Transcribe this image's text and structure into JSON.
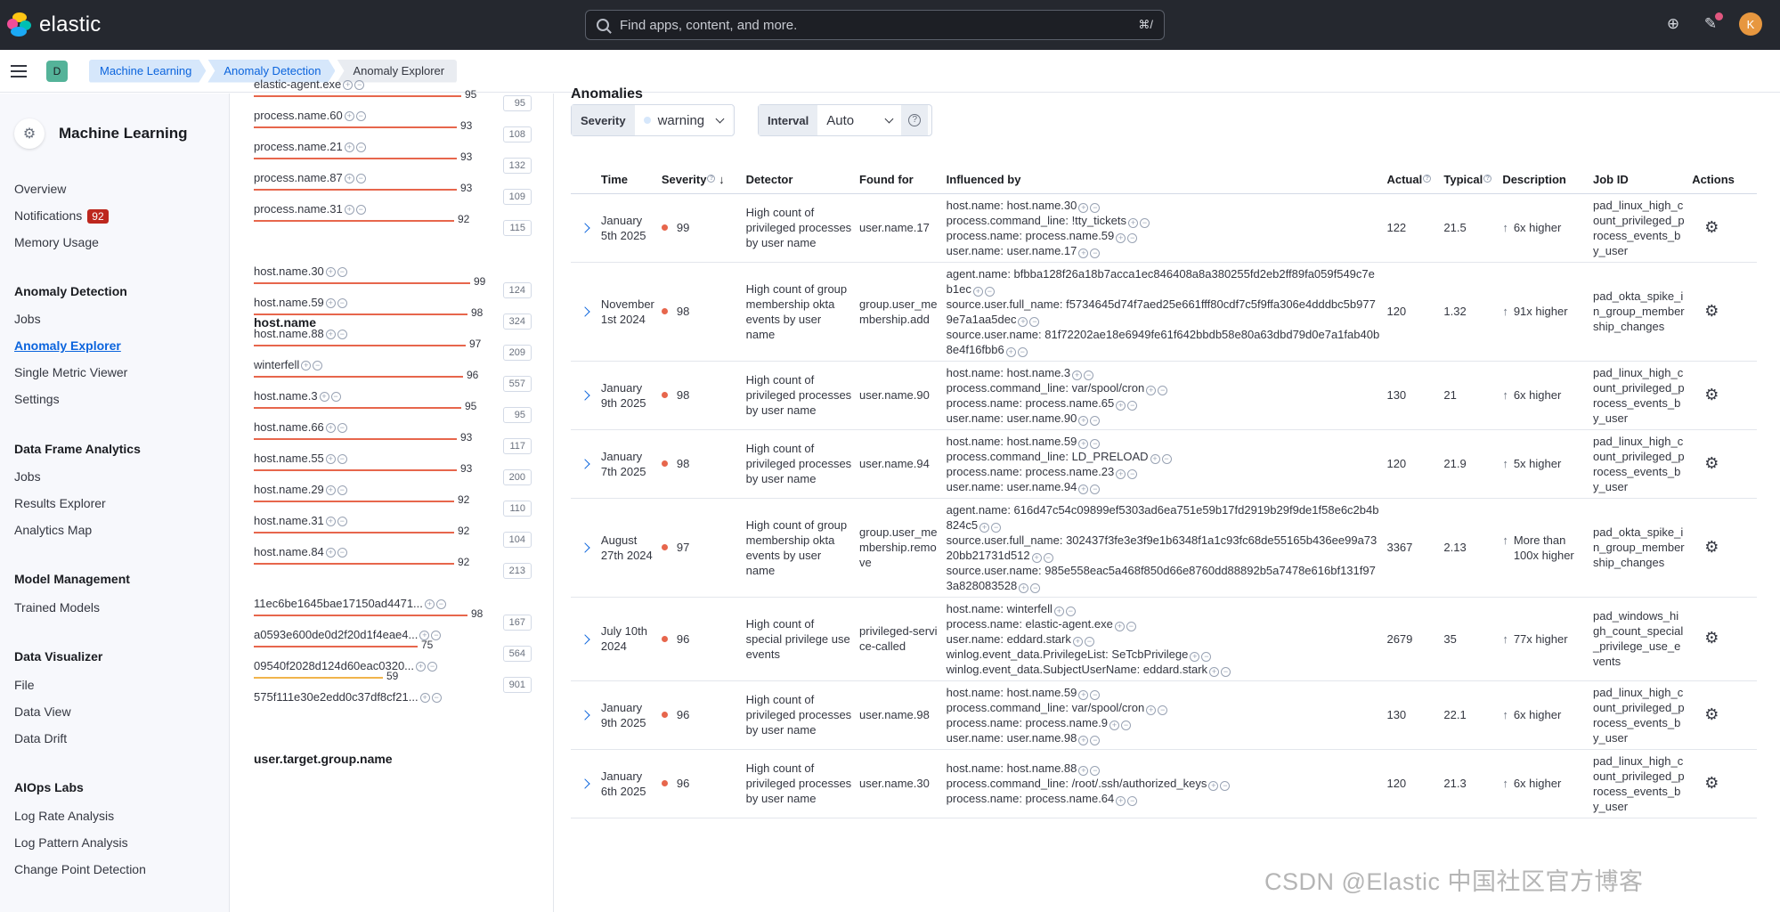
{
  "header": {
    "brand": "elastic",
    "search_placeholder": "Find apps, content, and more.",
    "search_shortcut": "⌘/",
    "avatar_initial": "K"
  },
  "breadcrumb": {
    "space_initial": "D",
    "items": [
      "Machine Learning",
      "Anomaly Detection",
      "Anomaly Explorer"
    ]
  },
  "sidebar": {
    "title": "Machine Learning",
    "top_items": [
      "Overview",
      "Notifications",
      "Memory Usage"
    ],
    "notifications_count": "92",
    "sections": [
      {
        "title": "Anomaly Detection",
        "items": [
          "Jobs",
          "Anomaly Explorer",
          "Single Metric Viewer",
          "Settings"
        ]
      },
      {
        "title": "Data Frame Analytics",
        "items": [
          "Jobs",
          "Results Explorer",
          "Analytics Map"
        ]
      },
      {
        "title": "Model Management",
        "items": [
          "Trained Models"
        ]
      },
      {
        "title": "Data Visualizer",
        "items": [
          "File",
          "Data View",
          "Data Drift"
        ]
      },
      {
        "title": "AIOps Labs",
        "items": [
          "Log Rate Analysis",
          "Log Pattern Analysis",
          "Change Point Detection"
        ]
      }
    ]
  },
  "influencers": {
    "top_rows": [
      {
        "name": "elastic-agent.exe",
        "score": 95,
        "count": 95
      },
      {
        "name": "process.name.60",
        "score": 93,
        "count": 108
      },
      {
        "name": "process.name.21",
        "score": 93,
        "count": 132
      },
      {
        "name": "process.name.87",
        "score": 93,
        "count": 109
      },
      {
        "name": "process.name.31",
        "score": 92,
        "count": 115
      }
    ],
    "host_heading": "host.name",
    "host_rows": [
      {
        "name": "host.name.30",
        "score": 99,
        "count": 124
      },
      {
        "name": "host.name.59",
        "score": 98,
        "count": 324
      },
      {
        "name": "host.name.88",
        "score": 97,
        "count": 209
      },
      {
        "name": "winterfell",
        "score": 96,
        "count": 557
      },
      {
        "name": "host.name.3",
        "score": 95,
        "count": 95
      },
      {
        "name": "host.name.66",
        "score": 93,
        "count": 117
      },
      {
        "name": "host.name.55",
        "score": 93,
        "count": 200
      },
      {
        "name": "host.name.29",
        "score": 92,
        "count": 110
      },
      {
        "name": "host.name.31",
        "score": 92,
        "count": 104
      },
      {
        "name": "host.name.84",
        "score": 92,
        "count": 213
      }
    ],
    "group_heading": "user.target.group.name",
    "group_rows": [
      {
        "name": "11ec6be1645bae17150ad4471...",
        "score": 98,
        "count": 167
      },
      {
        "name": "a0593e600de0d2f20d1f4eae4...",
        "score": 75,
        "count": 564
      },
      {
        "name": "09540f2028d124d60eac0320...",
        "score": 59,
        "count": 901
      },
      {
        "name": "575f111e30e2edd0c37df8cf21...",
        "score": "",
        "count": ""
      }
    ]
  },
  "anomalies": {
    "title": "Anomalies",
    "severity_label": "Severity",
    "severity_value": "warning",
    "interval_label": "Interval",
    "interval_value": "Auto",
    "columns": [
      "Time",
      "Severity",
      "Detector",
      "Found for",
      "Influenced by",
      "Actual",
      "Typical",
      "Description",
      "Job ID",
      "Actions"
    ],
    "rows": [
      {
        "time": "January 5th 2025",
        "severity": "99",
        "detector": "High count of privileged processes by user name",
        "found_for": "user.name.17",
        "influenced": [
          "host.name: host.name.30",
          "process.command_line: !tty_tickets",
          "process.name: process.name.59",
          "user.name: user.name.17"
        ],
        "actual": "122",
        "typical": "21.5",
        "description": "6x higher",
        "job_id": "pad_linux_high_count_privileged_process_events_by_user"
      },
      {
        "time": "November 1st 2024",
        "severity": "98",
        "detector": "High count of group membership okta events by user name",
        "found_for": "group.user_membership.add",
        "influenced": [
          "agent.name: bfbba128f26a18b7acca1ec846408a8a380255fd2eb2ff89fa059f549c7eb1ec",
          "source.user.full_name: f5734645d74f7aed25e661fff80cdf7c5f9ffa306e4dddbc5b9779e7a1aa5dec",
          "source.user.name: 81f72202ae18e6949fe61f642bbdb58e80a63dbd79d0e7a1fab40b8e4f16fbb6"
        ],
        "actual": "120",
        "typical": "1.32",
        "description": "91x higher",
        "job_id": "pad_okta_spike_in_group_membership_changes"
      },
      {
        "time": "January 9th 2025",
        "severity": "98",
        "detector": "High count of privileged processes by user name",
        "found_for": "user.name.90",
        "influenced": [
          "host.name: host.name.3",
          "process.command_line: var/spool/cron",
          "process.name: process.name.65",
          "user.name: user.name.90"
        ],
        "actual": "130",
        "typical": "21",
        "description": "6x higher",
        "job_id": "pad_linux_high_count_privileged_process_events_by_user"
      },
      {
        "time": "January 7th 2025",
        "severity": "98",
        "detector": "High count of privileged processes by user name",
        "found_for": "user.name.94",
        "influenced": [
          "host.name: host.name.59",
          "process.command_line: LD_PRELOAD",
          "process.name: process.name.23",
          "user.name: user.name.94"
        ],
        "actual": "120",
        "typical": "21.9",
        "description": "5x higher",
        "job_id": "pad_linux_high_count_privileged_process_events_by_user"
      },
      {
        "time": "August 27th 2024",
        "severity": "97",
        "detector": "High count of group membership okta events by user name",
        "found_for": "group.user_membership.remove",
        "influenced": [
          "agent.name: 616d47c54c09899ef5303ad6ea751e59b17fd2919b29f9de1f58e6c2b4b824c5",
          "source.user.full_name: 302437f3fe3e3f9e1b6348f1a1c93fc68de55165b436ee99a7320bb21731d512",
          "source.user.name: 985e558eac5a468f850d66e8760dd88892b5a7478e616bf131f973a828083528"
        ],
        "actual": "3367",
        "typical": "2.13",
        "description": "More than 100x higher",
        "job_id": "pad_okta_spike_in_group_membership_changes"
      },
      {
        "time": "July 10th 2024",
        "severity": "96",
        "detector": "High count of special privilege use events",
        "found_for": "privileged-service-called",
        "influenced": [
          "host.name: winterfell",
          "process.name: elastic-agent.exe",
          "user.name: eddard.stark",
          "winlog.event_data.PrivilegeList: SeTcbPrivilege",
          "winlog.event_data.SubjectUserName: eddard.stark"
        ],
        "actual": "2679",
        "typical": "35",
        "description": "77x higher",
        "job_id": "pad_windows_high_count_special_privilege_use_events"
      },
      {
        "time": "January 9th 2025",
        "severity": "96",
        "detector": "High count of privileged processes by user name",
        "found_for": "user.name.98",
        "influenced": [
          "host.name: host.name.59",
          "process.command_line: var/spool/cron",
          "process.name: process.name.9",
          "user.name: user.name.98"
        ],
        "actual": "130",
        "typical": "22.1",
        "description": "6x higher",
        "job_id": "pad_linux_high_count_privileged_process_events_by_user"
      },
      {
        "time": "January 6th 2025",
        "severity": "96",
        "detector": "High count of privileged processes by user name",
        "found_for": "user.name.30",
        "influenced": [
          "host.name: host.name.88",
          "process.command_line: /root/.ssh/authorized_keys",
          "process.name: process.name.64"
        ],
        "actual": "120",
        "typical": "21.3",
        "description": "6x higher",
        "job_id": "pad_linux_high_count_privileged_process_events_by_user"
      }
    ]
  },
  "watermark": "CSDN @Elastic 中国社区官方博客",
  "colors": {
    "header_bg": "#25282f",
    "accent": "#0b64dd",
    "critical": "#e7664c",
    "warning": "#f1b44c",
    "badge": "#bd271e"
  }
}
